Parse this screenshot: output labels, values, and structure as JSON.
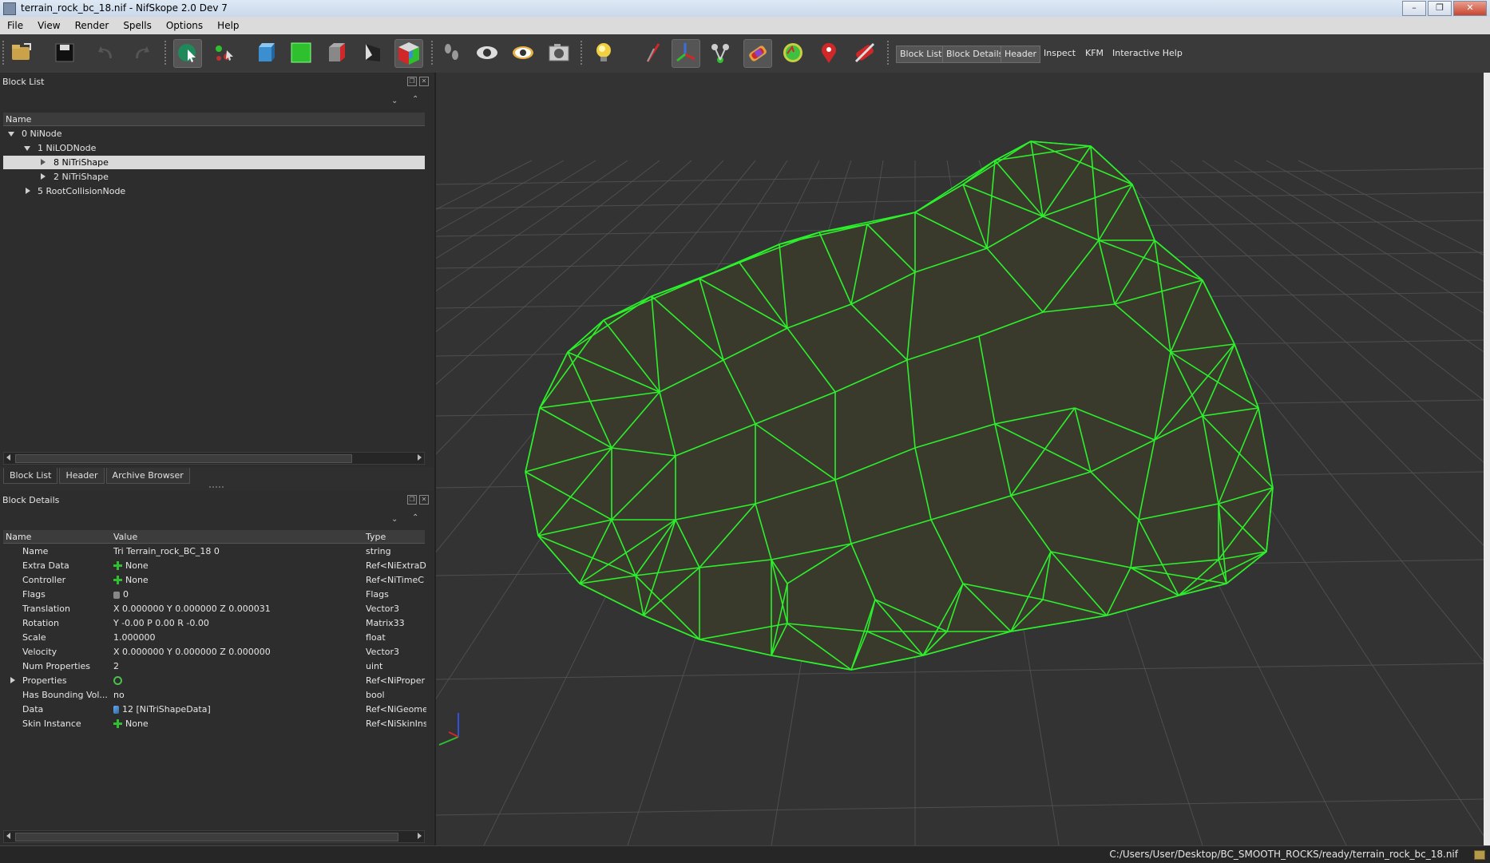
{
  "window": {
    "title": "terrain_rock_bc_18.nif - NifSkope 2.0 Dev 7"
  },
  "menu": [
    "File",
    "View",
    "Render",
    "Spells",
    "Options",
    "Help"
  ],
  "toolbar": {
    "text_buttons": [
      "Block List",
      "Block Details",
      "Header",
      "Inspect",
      "KFM",
      "Interactive Help"
    ]
  },
  "block_list": {
    "title": "Block List",
    "column": "Name",
    "rows": [
      {
        "label": "0 NiNode"
      },
      {
        "label": "1 NiLODNode"
      },
      {
        "label": "8 NiTriShape"
      },
      {
        "label": "2 NiTriShape"
      },
      {
        "label": "5 RootCollisionNode"
      }
    ]
  },
  "tabs": [
    "Block List",
    "Header",
    "Archive Browser"
  ],
  "block_details": {
    "title": "Block Details",
    "columns": {
      "name": "Name",
      "value": "Value",
      "type": "Type"
    },
    "rows": [
      {
        "name": "Name",
        "value": "Tri Terrain_rock_BC_18 0",
        "type": "string",
        "icon": ""
      },
      {
        "name": "Extra Data",
        "value": "None",
        "type": "Ref<NiExtraDa",
        "icon": "plus-icon"
      },
      {
        "name": "Controller",
        "value": "None",
        "type": "Ref<NiTimeC",
        "icon": "plus-icon"
      },
      {
        "name": "Flags",
        "value": "0",
        "type": "Flags",
        "icon": "flag-icon"
      },
      {
        "name": "Translation",
        "value": "X 0.000000 Y 0.000000 Z 0.000031",
        "type": "Vector3",
        "icon": ""
      },
      {
        "name": "Rotation",
        "value": "Y -0.00 P 0.00 R -0.00",
        "type": "Matrix33",
        "icon": ""
      },
      {
        "name": "Scale",
        "value": "1.000000",
        "type": "float",
        "icon": ""
      },
      {
        "name": "Velocity",
        "value": "X 0.000000 Y 0.000000 Z 0.000000",
        "type": "Vector3",
        "icon": ""
      },
      {
        "name": "Num Properties",
        "value": "2",
        "type": "uint",
        "icon": ""
      },
      {
        "name": "Properties",
        "value": "",
        "type": "Ref<NiProper",
        "icon": "refresh-icon"
      },
      {
        "name": "Has Bounding Vol...",
        "value": "no",
        "type": "bool",
        "icon": ""
      },
      {
        "name": "Data",
        "value": "12 [NiTriShapeData]",
        "type": "Ref<NiGeome",
        "icon": "link-icon"
      },
      {
        "name": "Skin Instance",
        "value": "None",
        "type": "Ref<NiSkinIns",
        "icon": "plus-icon"
      }
    ]
  },
  "status": {
    "path": "C:/Users/User/Desktop/BC_SMOOTH_ROCKS/ready/terrain_rock_bc_18.nif"
  },
  "colors": {
    "wireframe": "#2cf02c",
    "viewport_bg": "#333333",
    "grid": "#555555"
  }
}
